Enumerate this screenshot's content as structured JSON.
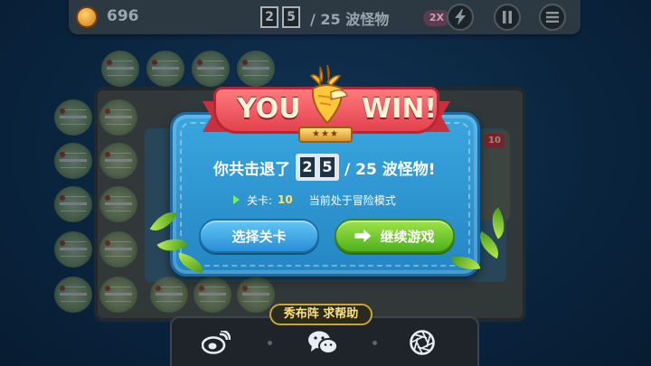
{
  "hud": {
    "coins": "696",
    "wave_digit_1": "2",
    "wave_digit_2": "5",
    "wave_total": "/ 25 波怪物",
    "speed_label": "2X"
  },
  "dialog": {
    "you_label": "YOU",
    "win_label": "WIN!",
    "stars": "★★★",
    "defeated_prefix": "你共击退了",
    "defeated_digit_1": "2",
    "defeated_digit_2": "5",
    "defeated_suffix": "/ 25 波怪物!",
    "level_label": "关卡:",
    "level_value": "10",
    "mode_text": "当前处于冒险模式",
    "select_level_button": "选择关卡",
    "continue_button": "继续游戏"
  },
  "board": {
    "badge": "10"
  },
  "share": {
    "label": "秀布阵 求帮助"
  },
  "colors": {
    "dialog_blue": "#2f98d4",
    "ribbon_red": "#e2424d",
    "button_green": "#4fb11c",
    "button_blue": "#2a8fd6",
    "gold": "#ffe27a"
  },
  "icons": {
    "coin": "carrot-coin-icon",
    "speed": "lightning-icon",
    "pause": "pause-icon",
    "menu": "menu-icon",
    "weibo": "weibo-icon",
    "wechat": "wechat-icon",
    "moments": "camera-aperture-icon"
  }
}
